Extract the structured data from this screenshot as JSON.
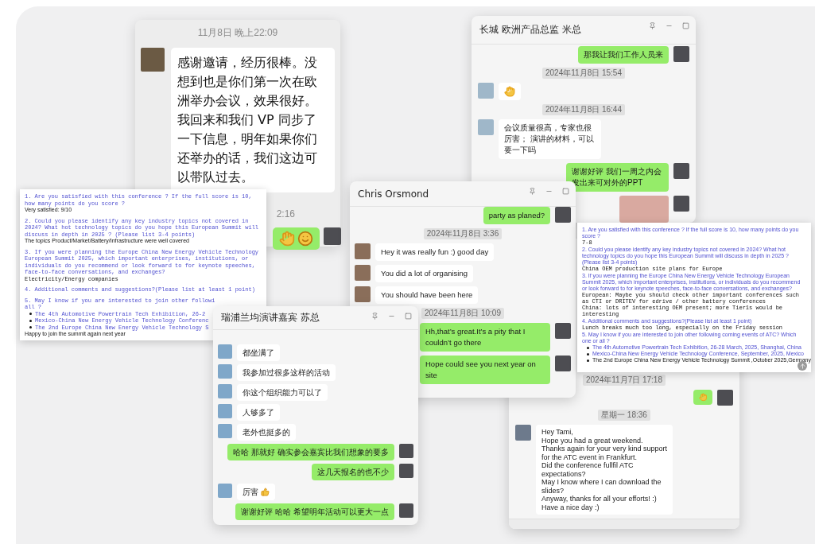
{
  "chat_screenshot": {
    "date": "11月8日 晚上22:09",
    "message": "感谢邀请，经历很棒。没想到也是你们第一次在欧洲举办会议，效果很好。我回来和我们 VP 同步了一下信息，明年如果你们还举办的话，我们这边可以带队过去。",
    "time": "2:16"
  },
  "chat_great_wall": {
    "title": "长城 欧洲产品总监 米总",
    "messages": [
      {
        "kind": "out",
        "text": "那我让我们工作人员来"
      },
      {
        "kind": "time",
        "text": "2024年11月8日 15:54"
      },
      {
        "kind": "in_emoji"
      },
      {
        "kind": "time",
        "text": "2024年11月8日 16:44"
      },
      {
        "kind": "in",
        "text": "会议质量很高，专家也很厉害； 演讲的材料，可以要一下吗"
      },
      {
        "kind": "out",
        "text": "谢谢好评 我们一周之内会发出来可对外的PPT"
      },
      {
        "kind": "out_photo"
      }
    ]
  },
  "chat_tami": {
    "messages": [
      {
        "kind": "time",
        "text": "2024年11月7日 17:18"
      },
      {
        "kind": "out_emoji"
      },
      {
        "kind": "time",
        "text": "星期一 18:36"
      },
      {
        "kind": "in",
        "text": "Hey Tami,\nHope you had a great weekend.\nThanks again for your very kind support\nfor the ATC event in Frankfurt.\nDid the conference fullfil ATC\nexpectations?\nMay I know where I can download the\nslides?\nAnyway, thanks for all your efforts! :)\nHave a nice day :)"
      }
    ]
  },
  "survey_left": {
    "items": [
      {
        "question": "1. Are you satisfied with this conference ? If the full score is 10, how many points do you score ?",
        "answers": [
          {
            "text": "Very satisfied: 9/10",
            "kind": "sans"
          }
        ]
      },
      {
        "question": "2. Could you please identify any key industry topics not covered in 2024? What hot technology topics do you hope this European Summit will discuss in depth in 2025 ? (Please list 3-4 points)",
        "answers": [
          {
            "text": "The topics Product/Market/Battery/Infrastructure were well covered",
            "kind": "sans"
          }
        ]
      },
      {
        "question": "3. If you were planning the Europe China New Energy Vehicle Technology European Summit 2025, which important enterprises, institutions, or individuals do you recommend or look forward to for keynote speeches, face-to-face conversations, and exchanges?",
        "answers": [
          {
            "text": "Electricity/Energy companies",
            "kind": "mono"
          }
        ]
      },
      {
        "question": "4. Additional comments and suggestions?(Please list at least 1 point)"
      },
      {
        "question": "5. May I know if you are interested to join other followi\nall ?",
        "bullets": [
          {
            "text": "The 4th Automotive Powertrain Tech Exhibition, 26-2",
            "kind": "link"
          },
          {
            "text": "Mexico-China New Energy Vehicle Technology Conferenc",
            "kind": "link"
          },
          {
            "text": "The 2nd Europe China New Energy Vehicle Technology S",
            "kind": "link"
          }
        ],
        "answers": [
          {
            "text": "Happy to join the summit again next year",
            "kind": "sans"
          }
        ]
      }
    ]
  },
  "chat_chris": {
    "title": "Chris Orsmond",
    "messages": [
      {
        "kind": "out",
        "text": "party as planed?"
      },
      {
        "kind": "time",
        "text": "2024年11月8日 3:36"
      },
      {
        "kind": "in",
        "text": "Hey it was really fun :) good day"
      },
      {
        "kind": "in",
        "text": "You did a lot of organising"
      },
      {
        "kind": "in",
        "text": "You should have been here"
      },
      {
        "kind": "time",
        "text": "2024年11月8日 10:09"
      },
      {
        "kind": "out",
        "text": "Hh,that’s great.It’s a pity that I couldn’t go there"
      },
      {
        "kind": "out",
        "text": "Hope could see you next year on site"
      }
    ]
  },
  "survey_right": {
    "items": [
      {
        "question": "1. Are you satisfied with this conference ? If the full score is 10, how many points do you score ?",
        "answers": [
          {
            "text": "7-8",
            "kind": "mono"
          }
        ]
      },
      {
        "question": "2. Could you please identify any key industry topics not covered in 2024? What hot technology topics do you hope this European Summit will discuss in depth in 2025 ? (Please list 3-4 points)",
        "answers": [
          {
            "text": "China OEM production site plans for Europe",
            "kind": "mono"
          }
        ]
      },
      {
        "question": "3. If you were planning the Europe China New Energy Vehicle Technology European Summit 2025, which important enterprises, institutions, or individuals do you recommend or look forward to for keynote speeches, face-to-face conversations, and exchanges?",
        "answers": [
          {
            "text": "European: Maybe you should check other important conferences such as CTI or DRITEV for edrive / other battery conferences",
            "kind": "mono"
          },
          {
            "text": "China: lots of interesting OEM present; more Tier1s would be interesting",
            "kind": "mono"
          }
        ]
      },
      {
        "question": "4. Additional comments and suggestions?(Please list at least 1 point)",
        "answers": [
          {
            "text": "Lunch breaks much too long, especially on the Friday session",
            "kind": "mono"
          }
        ]
      },
      {
        "question": "5. May I know if you are interested to join other following coming events of ATC? Which one or all ?",
        "bullets": [
          {
            "text": "The 4th Automotive Powertrain Tech Exhibition, 26-28 March, 2025, Shanghai, China",
            "kind": "link"
          },
          {
            "text": "Mexico-China New Energy Vehicle Technology Conference, September, 2025, Mexico",
            "kind": "link"
          },
          {
            "text": "The 2nd Europe China New Energy Vehicle Technology Summit ,October 2025,Germany",
            "kind": "plain"
          }
        ]
      }
    ]
  },
  "chat_ruipu": {
    "title": "瑞浦兰均演讲嘉宾 苏总",
    "messages": [
      {
        "kind": "in",
        "text": "都坐满了"
      },
      {
        "kind": "in",
        "text": "我参加过很多这样的活动"
      },
      {
        "kind": "in",
        "text": "你这个组织能力可以了"
      },
      {
        "kind": "in",
        "text": "人够多了"
      },
      {
        "kind": "in",
        "text": "老外也挺多的"
      },
      {
        "kind": "out",
        "text": "哈哈 那就好 确实参会嘉宾比我们想象的要多"
      },
      {
        "kind": "out",
        "text": "这几天报名的也不少"
      },
      {
        "kind": "in_thumbs",
        "text": "厉害"
      },
      {
        "kind": "out",
        "text": "谢谢好评 哈哈 希望明年活动可以更大一点"
      }
    ]
  }
}
